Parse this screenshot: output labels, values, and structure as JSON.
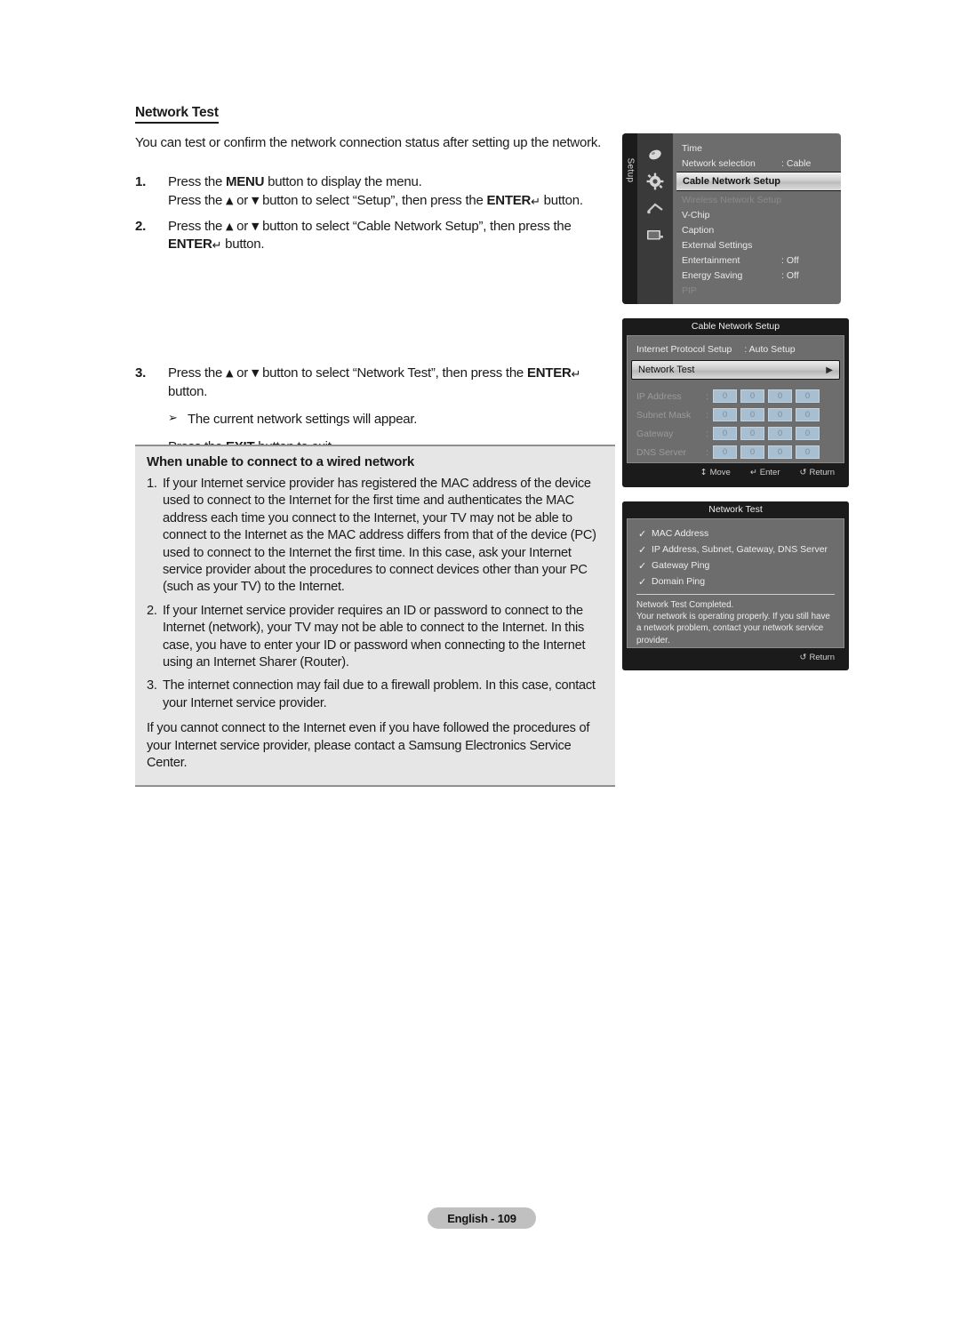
{
  "document": {
    "section_title": "Network Test",
    "intro": "You can test or confirm the network connection status after setting up the network.",
    "steps": [
      {
        "num": "1.",
        "line1_a": "Press the ",
        "line1_b": "MENU",
        "line1_c": " button to display the menu.",
        "line2_a": "Press the ",
        "line2_up": "▲",
        "line2_b": " or ",
        "line2_dn": "▼",
        "line2_c": " button to select “Setup”, then press the ",
        "line2_d": "ENTER",
        "line2_glyph": "↵",
        "line2_e": " button."
      },
      {
        "num": "2.",
        "line1_a": "Press the ",
        "line1_up": "▲",
        "line1_b": " or ",
        "line1_dn": "▼",
        "line1_c": " button to select “Cable Network Setup”, then press the",
        "line2_d": "ENTER",
        "line2_glyph": "↵",
        "line2_e": " button."
      },
      {
        "num": "3.",
        "line1_a": "Press the ",
        "line1_up": "▲",
        "line1_b": " or ",
        "line1_dn": "▼",
        "line1_c": " button to select “Network Test”, then press the ",
        "line1_d": "ENTER",
        "line1_glyph": "↵",
        "line2": "button."
      }
    ],
    "note_mark": "➢",
    "note_text": "The current network settings will appear.",
    "exit_a": "Press the ",
    "exit_b": "EXIT",
    "exit_c": " button to exit."
  },
  "callout": {
    "title": "When unable to connect to a wired network",
    "items": [
      {
        "num": "1.",
        "text": "If your Internet service provider has registered the MAC address of the device used to connect to the Internet for the first time and authenticates the MAC address each time you connect to the Internet, your TV may not be able to connect to the Internet as the MAC address differs from that of the device (PC) used to connect to the Internet the first time. In this case, ask your Internet service provider about the procedures to connect devices other than your PC (such as your TV) to the Internet."
      },
      {
        "num": "2.",
        "text": "If your Internet service provider requires an ID or password to connect to the Internet (network), your TV may not be able to connect to the Internet. In this case, you have to enter your ID or password when connecting to the Internet using an Internet Sharer (Router)."
      },
      {
        "num": "3.",
        "text": "The internet connection may fail due to a firewall problem. In this case, contact your Internet service provider."
      }
    ],
    "closing": "If you cannot connect to the Internet even if you have followed the procedures of your Internet service provider, please contact a Samsung Electronics Service Center."
  },
  "osd_setup": {
    "rail_label": "Setup",
    "icons": [
      "remote-icon",
      "gear-icon",
      "antenna-icon",
      "tv-icon"
    ],
    "rows": [
      {
        "label": "Time",
        "value": "",
        "state": "normal"
      },
      {
        "label": "Network selection",
        "value": ": Cable",
        "state": "normal"
      },
      {
        "label": "Cable Network Setup",
        "value": "",
        "state": "selected",
        "arrow": "▶"
      },
      {
        "label": "Wireless Network Setup",
        "value": "",
        "state": "dim"
      },
      {
        "label": "V-Chip",
        "value": "",
        "state": "normal"
      },
      {
        "label": "Caption",
        "value": "",
        "state": "normal"
      },
      {
        "label": "External Settings",
        "value": "",
        "state": "normal"
      },
      {
        "label": "Entertainment",
        "value": ": Off",
        "state": "normal"
      },
      {
        "label": "Energy Saving",
        "value": ": Off",
        "state": "normal"
      },
      {
        "label": "PIP",
        "value": "",
        "state": "dim"
      }
    ]
  },
  "osd_cable": {
    "title": "Cable Network Setup",
    "protocol_label": "Internet Protocol Setup",
    "protocol_value": ": Auto Setup",
    "network_test_label": "Network Test",
    "network_test_arrow": "▶",
    "fields": [
      {
        "label": "IP Address",
        "colon": ":",
        "cells": [
          "0",
          "0",
          "0",
          "0"
        ]
      },
      {
        "label": "Subnet Mask",
        "colon": ":",
        "cells": [
          "0",
          "0",
          "0",
          "0"
        ]
      },
      {
        "label": "Gateway",
        "colon": ":",
        "cells": [
          "0",
          "0",
          "0",
          "0"
        ]
      },
      {
        "label": "DNS Server",
        "colon": ":",
        "cells": [
          "0",
          "0",
          "0",
          "0"
        ]
      }
    ],
    "footer": [
      {
        "glyph": "↕",
        "label": "Move"
      },
      {
        "glyph": "↵",
        "label": "Enter"
      },
      {
        "glyph": "↺",
        "label": "Return"
      }
    ]
  },
  "osd_test": {
    "title": "Network Test",
    "check_glyph": "✓",
    "items": [
      "MAC Address",
      "IP Address, Subnet, Gateway, DNS Server",
      "Gateway Ping",
      "Domain Ping"
    ],
    "message_line1": "Network Test Completed.",
    "message_line2": "Your network is operating properly. If you still have a network problem, contact your network service provider.",
    "footer": [
      {
        "glyph": "↺",
        "label": "Return"
      }
    ]
  },
  "footer": {
    "page_label": "English - 109"
  }
}
